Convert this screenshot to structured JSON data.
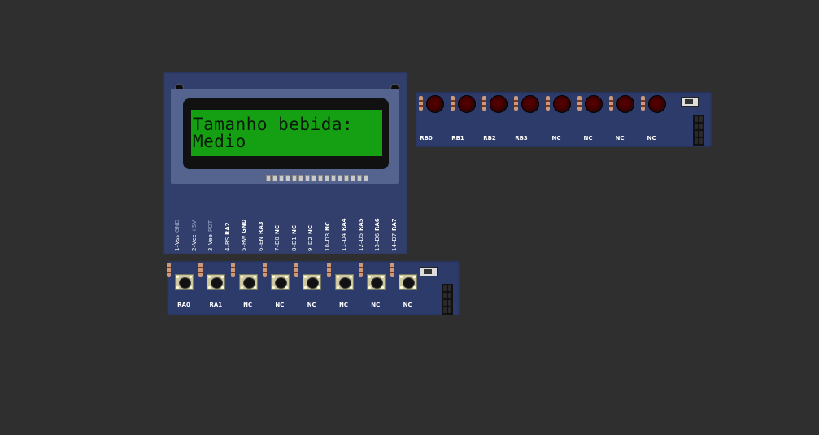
{
  "lcd": {
    "line1": "Tamanho bebida:",
    "line2": "Medio",
    "pins": [
      {
        "num": "1–Vss",
        "sig": "GND",
        "pwr": true
      },
      {
        "num": "2–Vcc",
        "sig": "+5V",
        "pwr": true
      },
      {
        "num": "3–Vee",
        "sig": "POT",
        "pwr": true
      },
      {
        "num": "4–RS",
        "sig": "RA2",
        "pwr": false
      },
      {
        "num": "5–RW",
        "sig": "GND",
        "pwr": false
      },
      {
        "num": "6–EN",
        "sig": "RA3",
        "pwr": false
      },
      {
        "num": "7–D0",
        "sig": "NC",
        "pwr": false
      },
      {
        "num": "8–D1",
        "sig": "NC",
        "pwr": false
      },
      {
        "num": "9–D2",
        "sig": "NC",
        "pwr": false
      },
      {
        "num": "10–D3",
        "sig": "NC",
        "pwr": false
      },
      {
        "num": "11–D4",
        "sig": "RA4",
        "pwr": false
      },
      {
        "num": "12–D5",
        "sig": "RA5",
        "pwr": false
      },
      {
        "num": "13–D6",
        "sig": "RA6",
        "pwr": false
      },
      {
        "num": "14–D7",
        "sig": "RA7",
        "pwr": false
      }
    ]
  },
  "led_board": {
    "labels": [
      "RB0",
      "RB1",
      "RB2",
      "RB3",
      "NC",
      "NC",
      "NC",
      "NC"
    ],
    "led_color": "#5a0000"
  },
  "button_board": {
    "labels": [
      "RA0",
      "RA1",
      "NC",
      "NC",
      "NC",
      "NC",
      "NC",
      "NC"
    ]
  },
  "colors": {
    "background": "#2f2f2f",
    "board": "#2d3b6a",
    "lcd_screen": "#15a014"
  }
}
